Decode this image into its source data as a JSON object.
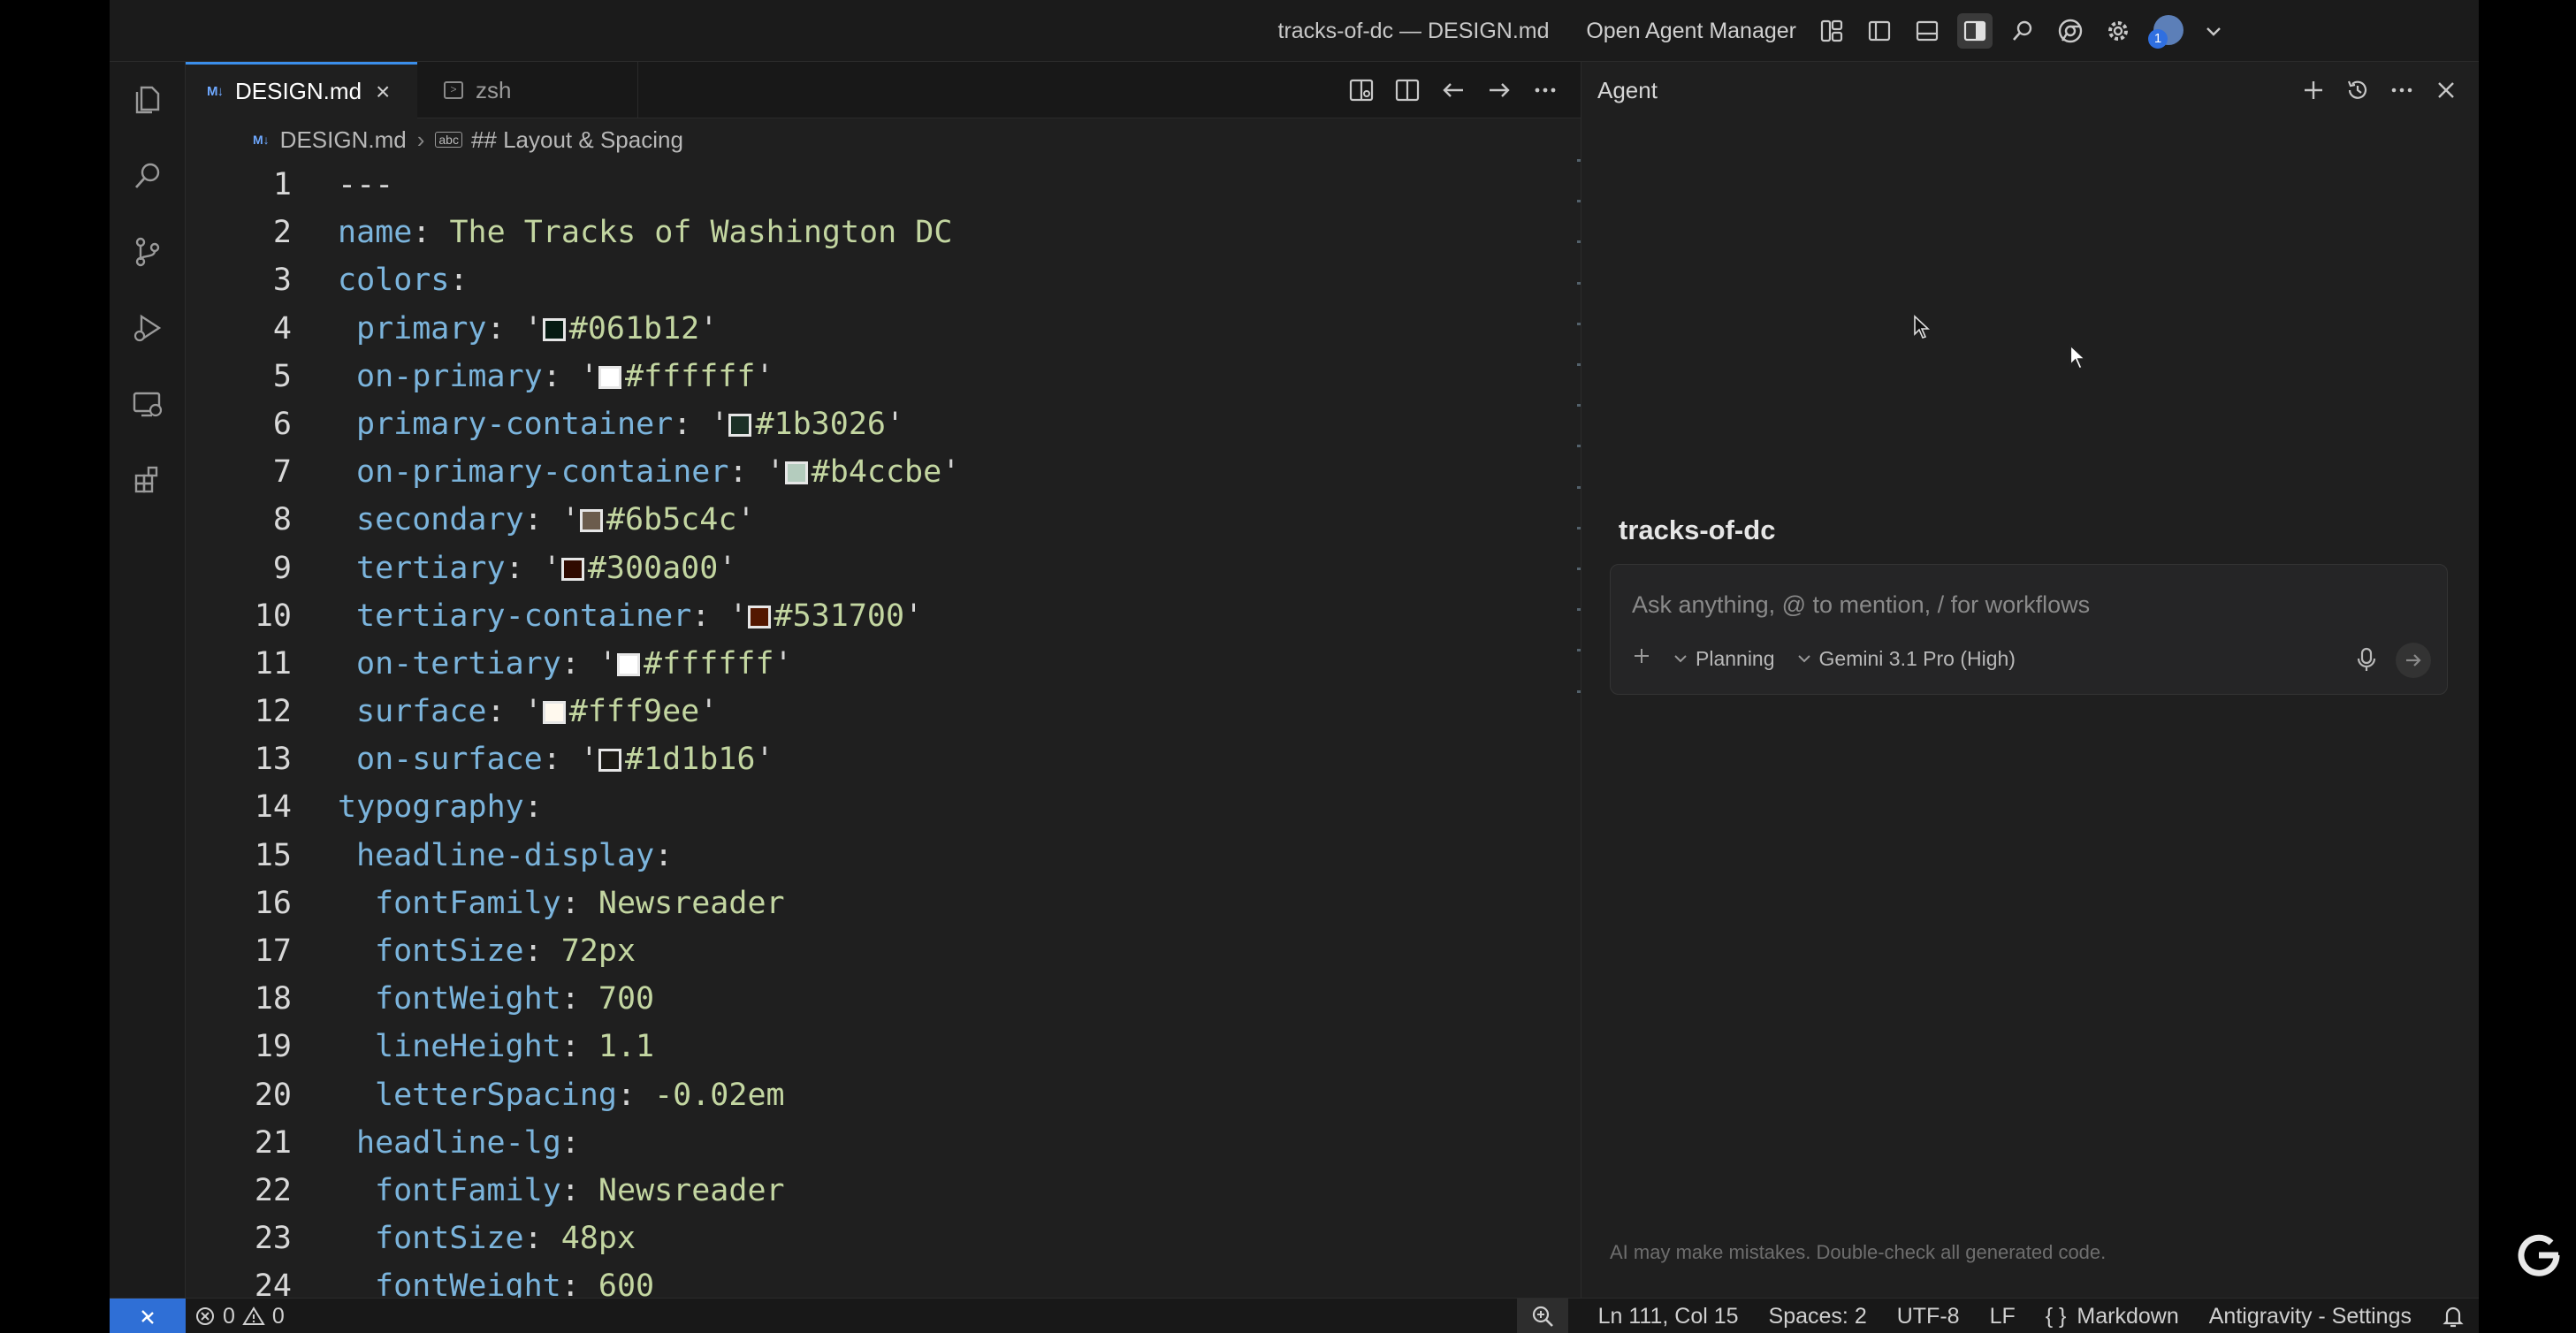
{
  "window": {
    "title": "tracks-of-dc — DESIGN.md"
  },
  "titlebar": {
    "agent_manager_label": "Open Agent Manager",
    "icons": [
      "layout-customize-icon",
      "toggle-primary-sidebar-icon",
      "toggle-panel-icon",
      "toggle-secondary-sidebar-icon",
      "search-icon",
      "chrome-icon",
      "settings-gear-icon",
      "account-avatar-icon",
      "chevron-down-icon"
    ],
    "account_badge": "1"
  },
  "activity_bar": {
    "items": [
      "explorer-icon",
      "search-icon",
      "source-control-icon",
      "run-debug-icon",
      "remote-explorer-icon",
      "extensions-icon"
    ]
  },
  "editor": {
    "tabs": [
      {
        "label": "DESIGN.md",
        "icon": "M↓",
        "active": true
      },
      {
        "label": "zsh",
        "icon": "terminal-icon",
        "active": false
      }
    ],
    "breadcrumb": {
      "file": "DESIGN.md",
      "symbol": "## Layout & Spacing",
      "symbol_icon": "abc"
    },
    "lines": [
      {
        "n": "1",
        "key": "",
        "text": "---"
      },
      {
        "n": "2",
        "key": "name",
        "text": "The Tracks of Washington DC"
      },
      {
        "n": "3",
        "key": "colors",
        "text": ""
      },
      {
        "n": "4",
        "key": "primary",
        "text": "#061b12",
        "swatch": "#061b12"
      },
      {
        "n": "5",
        "key": "on-primary",
        "text": "#ffffff",
        "swatch": "#ffffff"
      },
      {
        "n": "6",
        "key": "primary-container",
        "text": "#1b3026",
        "swatch": "#1b3026"
      },
      {
        "n": "7",
        "key": "on-primary-container",
        "text": "#b4ccbe",
        "swatch": "#b4ccbe"
      },
      {
        "n": "8",
        "key": "secondary",
        "text": "#6b5c4c",
        "swatch": "#6b5c4c"
      },
      {
        "n": "9",
        "key": "tertiary",
        "text": "#300a00",
        "swatch": "#300a00"
      },
      {
        "n": "10",
        "key": "tertiary-container",
        "text": "#531700",
        "swatch": "#531700"
      },
      {
        "n": "11",
        "key": "on-tertiary",
        "text": "#ffffff",
        "swatch": "#ffffff"
      },
      {
        "n": "12",
        "key": "surface",
        "text": "#fff9ee",
        "swatch": "#fff9ee"
      },
      {
        "n": "13",
        "key": "on-surface",
        "text": "#1d1b16",
        "swatch": "#1d1b16"
      },
      {
        "n": "14",
        "key": "typography",
        "text": ""
      },
      {
        "n": "15",
        "key": "headline-display",
        "text": ""
      },
      {
        "n": "16",
        "key": "fontFamily",
        "text": "Newsreader"
      },
      {
        "n": "17",
        "key": "fontSize",
        "text": "72px"
      },
      {
        "n": "18",
        "key": "fontWeight",
        "text": "700"
      },
      {
        "n": "19",
        "key": "lineHeight",
        "text": "1.1"
      },
      {
        "n": "20",
        "key": "letterSpacing",
        "text": "-0.02em"
      },
      {
        "n": "21",
        "key": "headline-lg",
        "text": ""
      },
      {
        "n": "22",
        "key": "fontFamily",
        "text": "Newsreader"
      },
      {
        "n": "23",
        "key": "fontSize",
        "text": "48px"
      },
      {
        "n": "24",
        "key": "fontWeight",
        "text": "600"
      }
    ]
  },
  "agent": {
    "title": "Agent",
    "project": "tracks-of-dc",
    "input_placeholder": "Ask anything, @ to mention, / for workflows",
    "mode": "Planning",
    "model": "Gemini 3.1 Pro (High)",
    "disclaimer": "AI may make mistakes. Double-check all generated code."
  },
  "status_bar": {
    "errors": "0",
    "warnings": "0",
    "position": "Ln 111, Col 15",
    "spaces": "Spaces: 2",
    "encoding": "UTF-8",
    "eol": "LF",
    "language": "Markdown",
    "settings": "Antigravity - Settings"
  },
  "colors": {
    "accent": "#3b8eea",
    "remote_indicator": "#2f6fd6",
    "yaml_key": "#7bb4dc",
    "yaml_value": "#c3d6a1"
  }
}
